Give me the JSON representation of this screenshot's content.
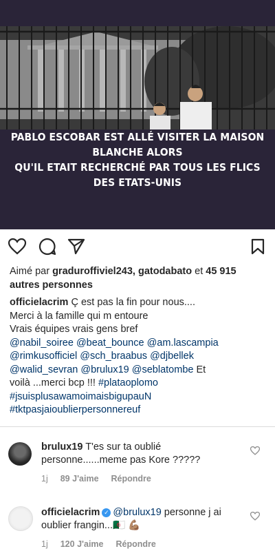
{
  "post": {
    "image_caption_line1": "PABLO ESCOBAR EST ALLÉ VISITER LA MAISON BLANCHE ALORS",
    "image_caption_line2": "QU'IL ETAIT RECHERCHÉ PAR TOUS LES FLICS DES ETATS-UNIS"
  },
  "likes": {
    "prefix": "Aimé par ",
    "user1": "graduroffiviel243",
    "sep": ", ",
    "user2": "gatodabato",
    "and": " et ",
    "count": "45 915",
    "suffix": "autres personnes"
  },
  "caption": {
    "user": "officielacrim",
    "line1": " Ç est pas la fin pour nous....",
    "line2": "Merci à la famille qui m entoure",
    "line3": "Vrais équipes vrais gens bref",
    "mentions": [
      "@nabil_soiree",
      "@beat_bounce",
      "@am.lascampia",
      "@rimkusofficiel",
      "@sch_braabus",
      "@djbellek",
      "@walid_sevran",
      "@brulux19",
      "@seblatombe"
    ],
    "tail1": " Et",
    "tail2": "voilà ...merci bcp !!! ",
    "hashtags": [
      "#plataoplomo",
      "#jsuisplusawamoimaisbigupauN",
      "#tktpasjaioublierpersonnereuf"
    ]
  },
  "comments": [
    {
      "user": "brulux19",
      "text1": "T'es sur ta oublié",
      "text2": "personne......meme pas Kore ?????",
      "time": "1j",
      "likes": "89 J'aime",
      "reply": "Répondre"
    },
    {
      "user": "officielacrim",
      "mention": "@brulux19",
      "text1": " personne j ai",
      "text2": "oublier frangin...",
      "emoji": "🇩🇿 💪🏽",
      "time": "1j",
      "likes": "120 J'aime",
      "reply": "Répondre"
    }
  ]
}
